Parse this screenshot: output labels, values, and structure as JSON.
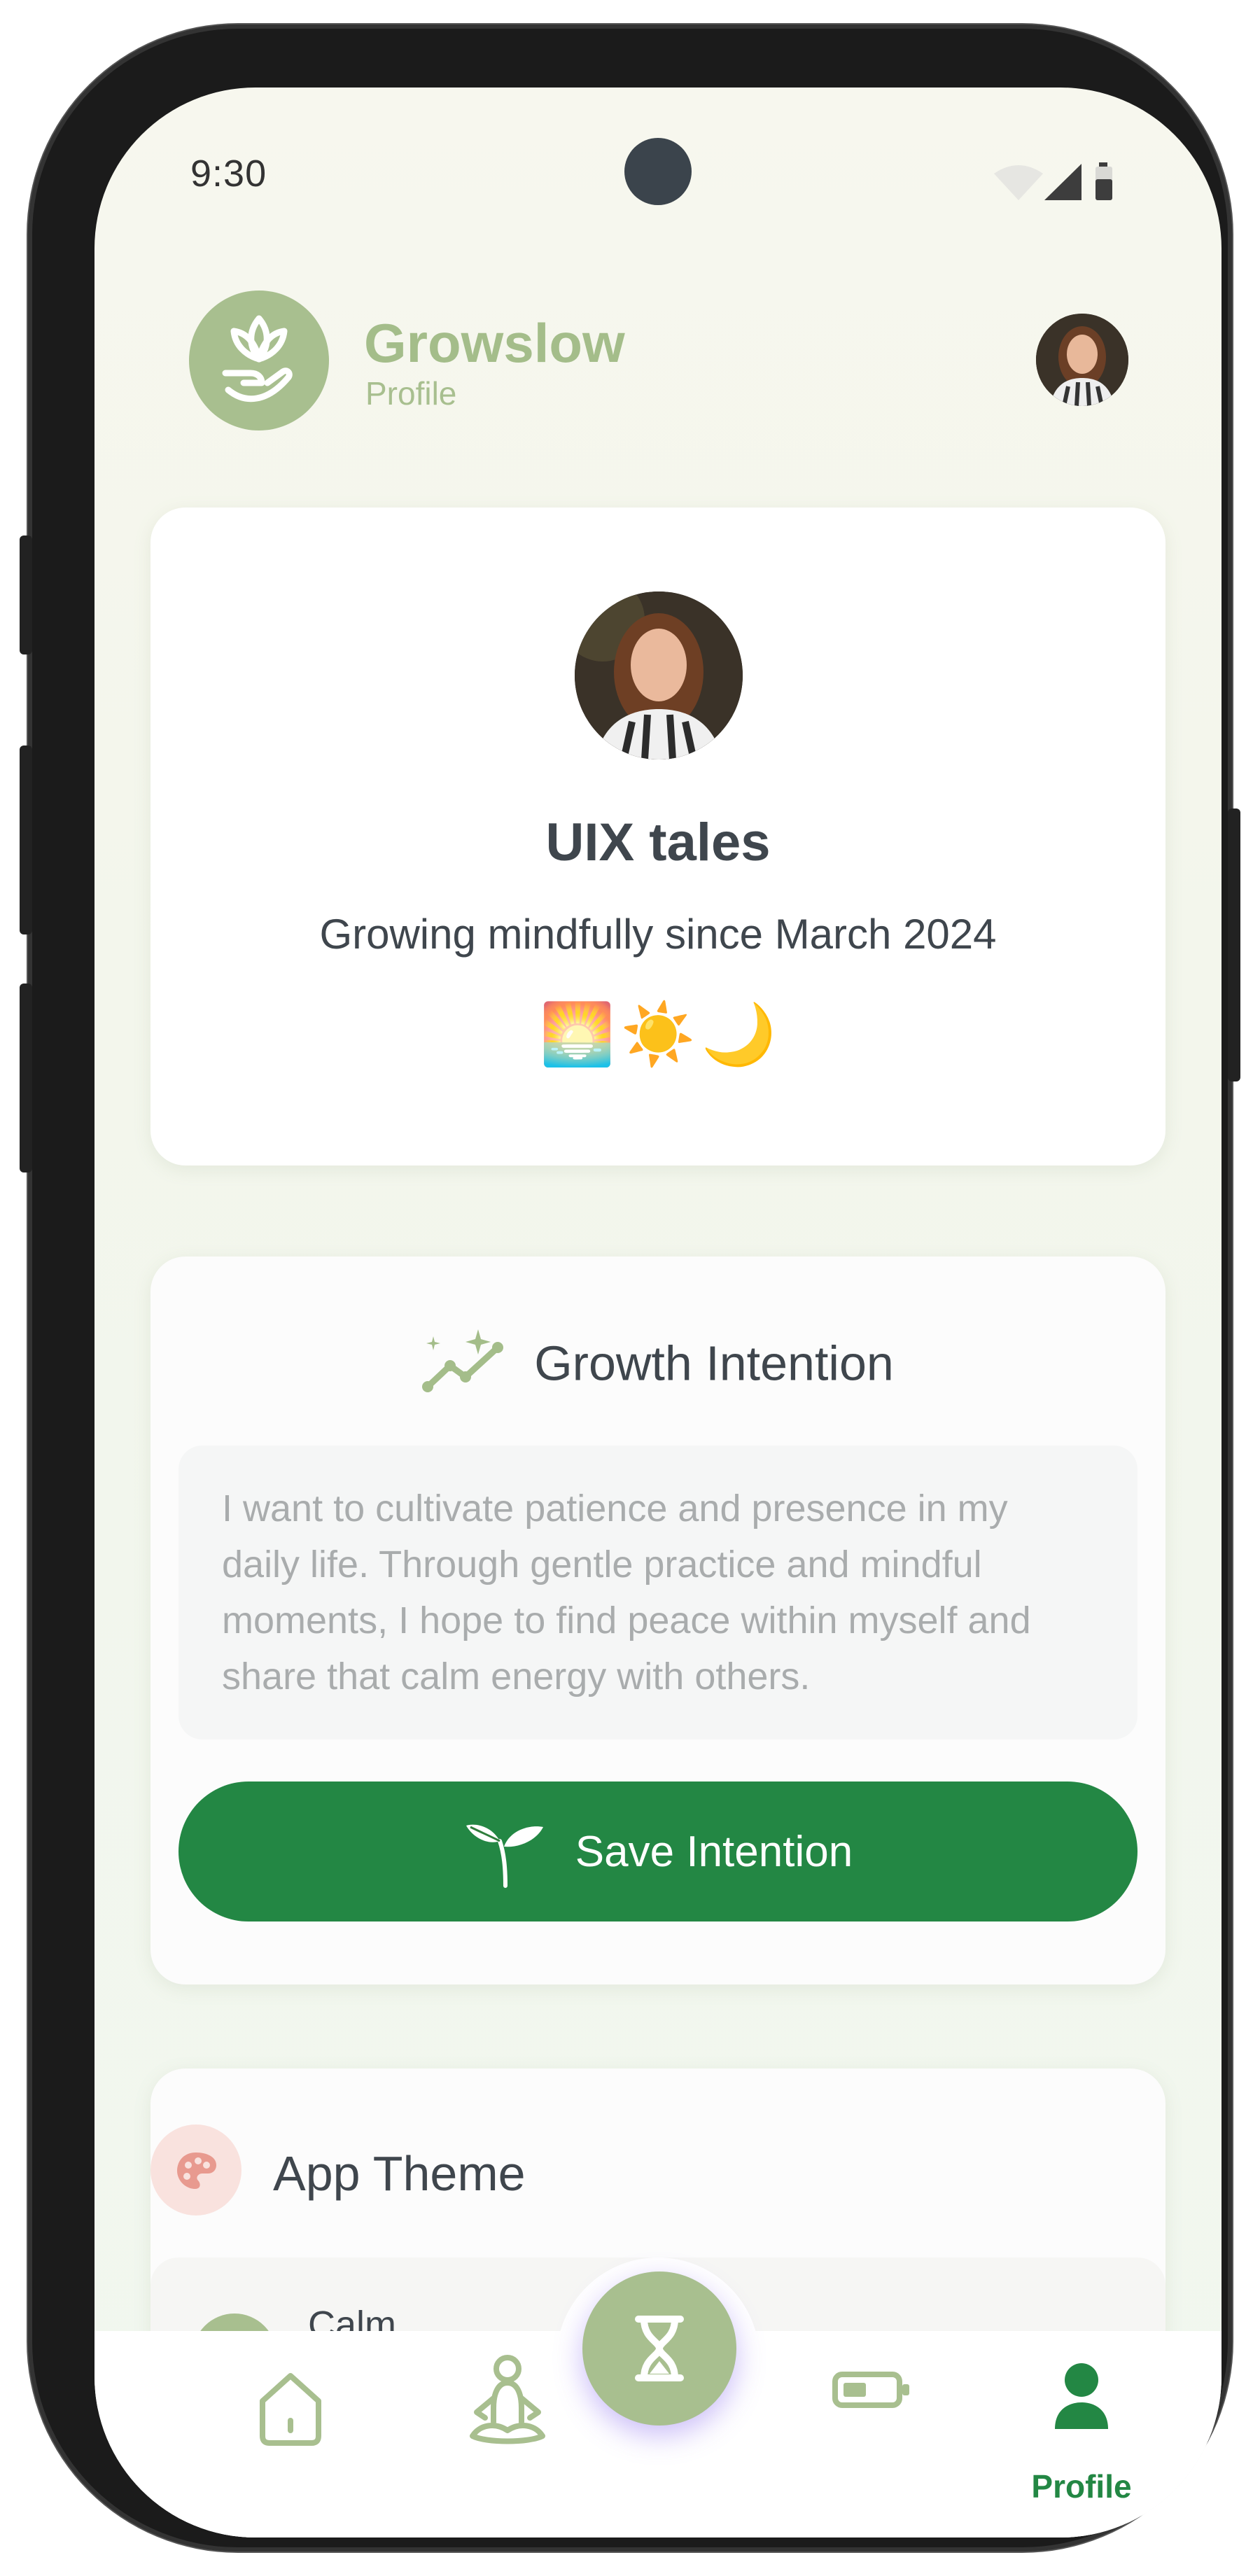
{
  "status_bar": {
    "time": "9:30"
  },
  "header": {
    "app_name": "Growslow",
    "page": "Profile"
  },
  "profile": {
    "name": "UIX tales",
    "tagline": "Growing mindfully since March 2024",
    "emojis": [
      "🌅",
      "☀️",
      "🌙"
    ]
  },
  "intention": {
    "title": "Growth Intention",
    "text": "I want to cultivate patience and presence in my daily life. Through gentle practice and mindful moments, I hope to find peace within myself and share that calm energy with others.",
    "save_label": "Save Intention"
  },
  "theme": {
    "title": "App Theme",
    "option_label": "Calm"
  },
  "nav": {
    "items": [
      "home-icon",
      "meditation-icon",
      "timer-icon",
      "energy-icon",
      "profile-icon"
    ],
    "active_label": "Profile"
  },
  "colors": {
    "accent": "#238744",
    "sage": "#a8bf8f",
    "text": "#3f464d"
  }
}
